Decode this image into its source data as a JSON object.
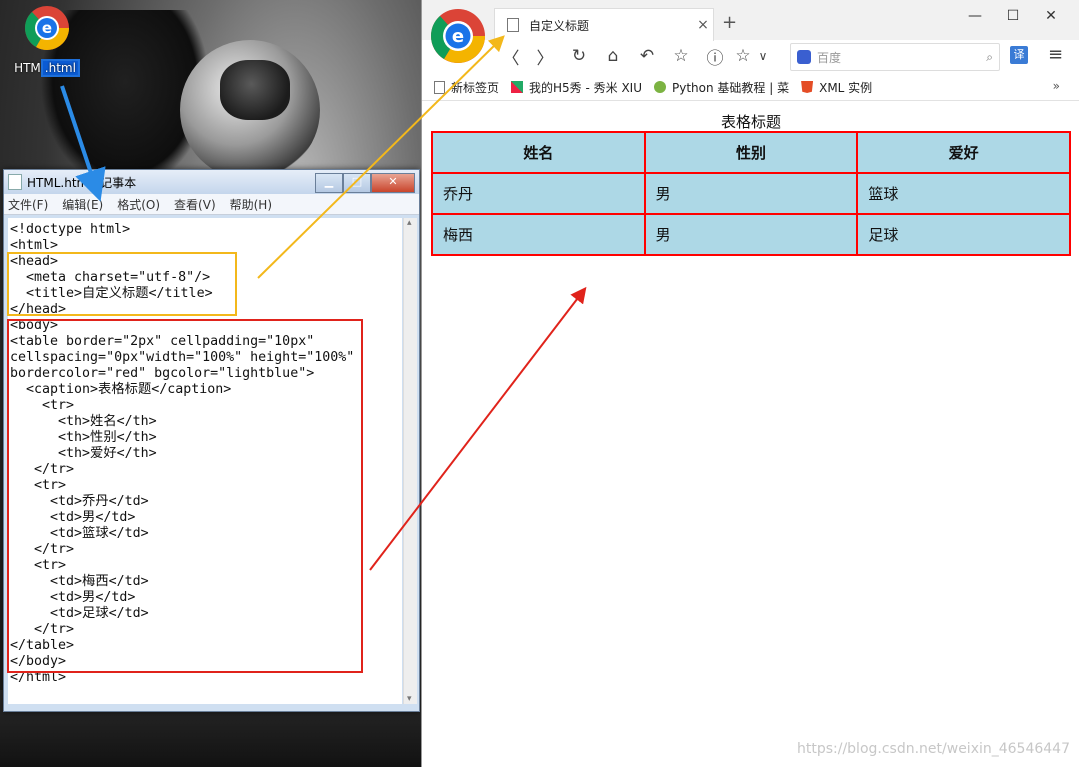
{
  "desktop": {
    "icon_label_prefix": "HTM",
    "icon_label_selected": ".html"
  },
  "notepad": {
    "title": "HTML.htm - 记事本",
    "window_buttons": {
      "minimize": "▁",
      "maximize": "□",
      "close": "✕"
    },
    "menu": [
      "文件(F)",
      "编辑(E)",
      "格式(O)",
      "查看(V)",
      "帮助(H)"
    ],
    "code": "<!doctype html>\n<html>\n<head>\n  <meta charset=\"utf-8\"/>\n  <title>自定义标题</title>\n</head>\n<body>\n<table border=\"2px\" cellpadding=\"10px\"\ncellspacing=\"0px\"width=\"100%\" height=\"100%\"\nbordercolor=\"red\" bgcolor=\"lightblue\">\n  <caption>表格标题</caption>\n    <tr>\n      <th>姓名</th>\n      <th>性别</th>\n      <th>爱好</th>\n   </tr>\n   <tr>\n     <td>乔丹</td>\n     <td>男</td>\n     <td>篮球</td>\n   </tr>\n   <tr>\n     <td>梅西</td>\n     <td>男</td>\n     <td>足球</td>\n   </tr>\n</table>\n</body>\n</html>"
  },
  "browser": {
    "tab_title": "自定义标题",
    "tab_close": "×",
    "new_tab": "+",
    "window_controls": [
      "—",
      "☐",
      "✕"
    ],
    "toolbar": {
      "back": "〈",
      "forward": "〉",
      "reload": "↻",
      "home": "⌂",
      "undo": "↶",
      "star": "☆",
      "info": "ⓘ",
      "star2": "☆",
      "dropdown": "∨"
    },
    "omnibox_text": "百度",
    "translate_icon": "译",
    "menu_icon": "≡",
    "bookmarks": [
      "新标签页",
      "我的H5秀 - 秀米 XIU",
      "Python 基础教程 | 菜",
      "XML 实例"
    ],
    "bookmarks_more": "»",
    "page": {
      "caption": "表格标题",
      "headers": [
        "姓名",
        "性别",
        "爱好"
      ],
      "rows": [
        [
          "乔丹",
          "男",
          "篮球"
        ],
        [
          "梅西",
          "男",
          "足球"
        ]
      ]
    },
    "watermark": "https://blog.csdn.net/weixin_46546447"
  },
  "colors": {
    "table_bg": "#add8e6",
    "table_border": "#ff0000",
    "highlight_yellow": "#f3b81b",
    "highlight_red": "#e0231b",
    "arrow_blue": "#2b8be6"
  }
}
